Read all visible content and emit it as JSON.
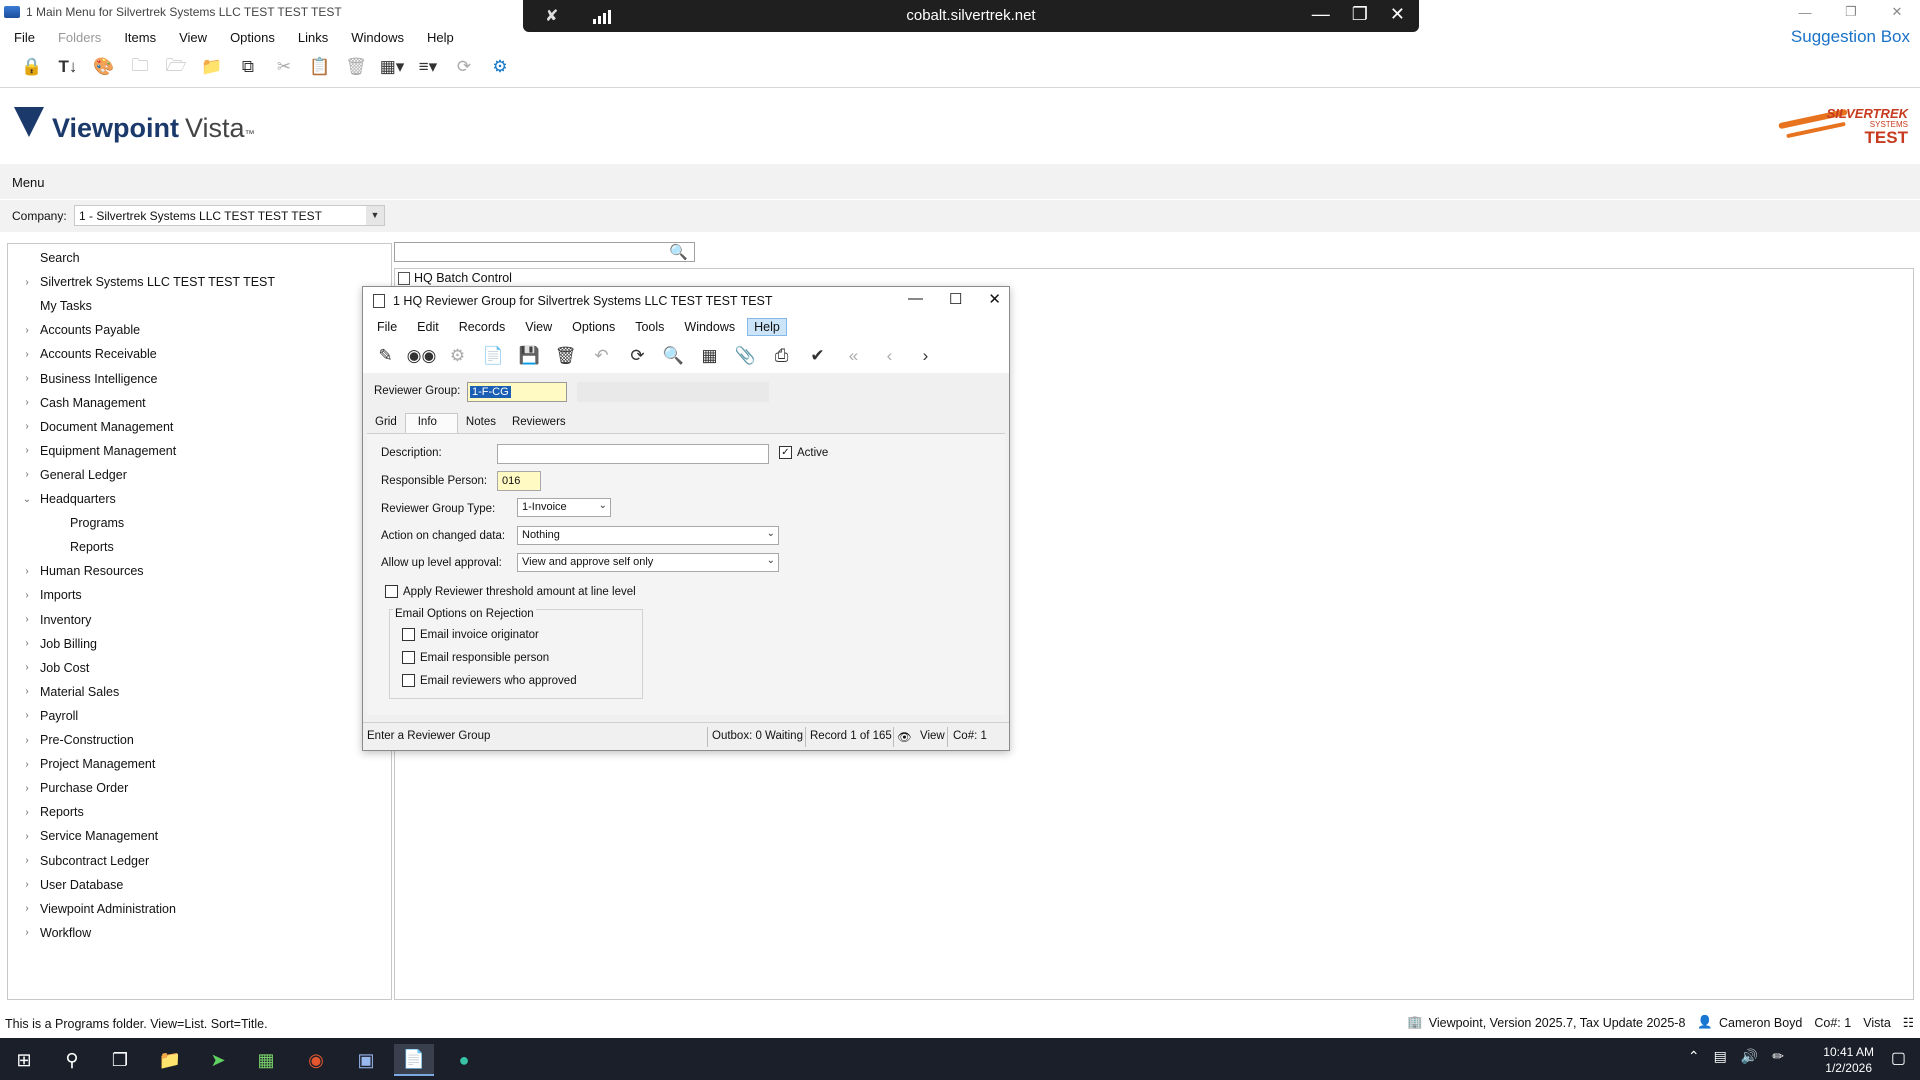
{
  "window": {
    "title": "1 Main Menu for Silvertrek Systems LLC TEST TEST TEST",
    "controls": [
      "—",
      "❐",
      "✕"
    ]
  },
  "remote_bar": {
    "host": "cobalt.silvertrek.net"
  },
  "menubar": {
    "items": [
      "File",
      "Folders",
      "Items",
      "View",
      "Options",
      "Links",
      "Windows",
      "Help"
    ],
    "suggestion": "Suggestion Box"
  },
  "logo": {
    "brand": "Viewpoint",
    "product": "Vista",
    "tm": "™"
  },
  "corp_logo": {
    "line1": "SILVERTREK",
    "line2": "SYSTEMS",
    "line3": "TEST"
  },
  "menu_label": "Menu",
  "company": {
    "label": "Company:",
    "value": "1 - Silvertrek Systems LLC TEST TEST TEST"
  },
  "tree": {
    "items": [
      {
        "label": "Search",
        "arrow": ""
      },
      {
        "label": "Silvertrek Systems LLC TEST TEST TEST",
        "arrow": "›"
      },
      {
        "label": "My Tasks",
        "arrow": ""
      },
      {
        "label": "Accounts Payable",
        "arrow": "›"
      },
      {
        "label": "Accounts Receivable",
        "arrow": "›"
      },
      {
        "label": "Business Intelligence",
        "arrow": "›"
      },
      {
        "label": "Cash Management",
        "arrow": "›"
      },
      {
        "label": "Document Management",
        "arrow": "›"
      },
      {
        "label": "Equipment Management",
        "arrow": "›"
      },
      {
        "label": "General Ledger",
        "arrow": "›"
      },
      {
        "label": "Headquarters",
        "arrow": "⌄"
      },
      {
        "label": "Programs",
        "arrow": ""
      },
      {
        "label": "Reports",
        "arrow": ""
      },
      {
        "label": "Human Resources",
        "arrow": "›"
      },
      {
        "label": "Imports",
        "arrow": "›"
      },
      {
        "label": "Inventory",
        "arrow": "›"
      },
      {
        "label": "Job Billing",
        "arrow": "›"
      },
      {
        "label": "Job Cost",
        "arrow": "›"
      },
      {
        "label": "Material Sales",
        "arrow": "›"
      },
      {
        "label": "Payroll",
        "arrow": "›"
      },
      {
        "label": "Pre-Construction",
        "arrow": "›"
      },
      {
        "label": "Project Management",
        "arrow": "›"
      },
      {
        "label": "Purchase Order",
        "arrow": "›"
      },
      {
        "label": "Reports",
        "arrow": "›"
      },
      {
        "label": "Service Management",
        "arrow": "›"
      },
      {
        "label": "Subcontract Ledger",
        "arrow": "›"
      },
      {
        "label": "User Database",
        "arrow": "›"
      },
      {
        "label": "Viewpoint Administration",
        "arrow": "›"
      },
      {
        "label": "Workflow",
        "arrow": "›"
      }
    ]
  },
  "workspace": {
    "open_tab": "HQ Batch Control"
  },
  "dialog": {
    "title": "1 HQ Reviewer Group for Silvertrek Systems LLC TEST TEST TEST",
    "menu": [
      "File",
      "Edit",
      "Records",
      "View",
      "Options",
      "Tools",
      "Windows",
      "Help"
    ],
    "reviewer_group_label": "Reviewer Group:",
    "reviewer_group_value": "1-F-CG",
    "tabs": [
      "Grid",
      "Info",
      "Notes",
      "Reviewers"
    ],
    "form": {
      "description_label": "Description:",
      "description_value": "",
      "active_label": "Active",
      "active_checked": true,
      "responsible_label": "Responsible  Person:",
      "responsible_value": "016",
      "type_label": "Reviewer Group Type:",
      "type_value": "1-Invoice",
      "action_label": "Action on changed data:",
      "action_value": "Nothing",
      "uplevel_label": "Allow up level approval:",
      "uplevel_value": "View and approve self only",
      "threshold_label": "Apply Reviewer threshold amount at line level",
      "email_group_label": "Email Options on Rejection",
      "email_originator": "Email invoice originator",
      "email_responsible": "Email responsible person",
      "email_reviewers": "Email reviewers who approved"
    },
    "status": {
      "hint": "Enter a Reviewer Group",
      "outbox": "Outbox: 0 Waiting",
      "record": "Record 1 of 165",
      "mode": "View",
      "co": "Co#: 1"
    }
  },
  "status": {
    "left": "This is a Programs folder. View=List. Sort=Title.",
    "version": "Viewpoint, Version 2025.7, Tax Update 2025-8",
    "user": "Cameron Boyd",
    "co": "Co#: 1",
    "app": "Vista"
  },
  "taskbar": {
    "time": "10:41 AM",
    "date": "1/2/2026"
  }
}
